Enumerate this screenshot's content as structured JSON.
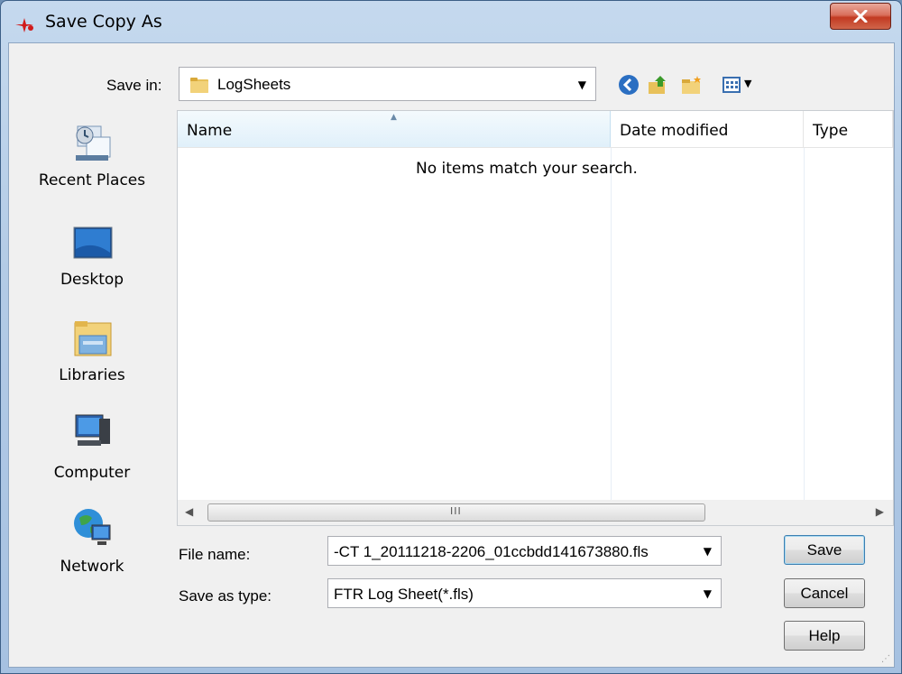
{
  "window": {
    "title": "Save Copy As"
  },
  "save_in": {
    "label": "Save in:",
    "value": "LogSheets"
  },
  "places": [
    {
      "label": "Recent Places",
      "icon": "recent-places-icon"
    },
    {
      "label": "Desktop",
      "icon": "desktop-icon"
    },
    {
      "label": "Libraries",
      "icon": "libraries-icon"
    },
    {
      "label": "Computer",
      "icon": "computer-icon"
    },
    {
      "label": "Network",
      "icon": "network-icon"
    }
  ],
  "list": {
    "columns": [
      "Name",
      "Date modified",
      "Type"
    ],
    "empty_message": "No items match your search.",
    "scroll_grip": "III"
  },
  "file_name": {
    "label": "File name:",
    "value": "-CT 1_20111218-2206_01ccbdd141673880.fls"
  },
  "save_as_type": {
    "label": "Save as type:",
    "value": "FTR Log Sheet(*.fls)"
  },
  "buttons": {
    "save": "Save",
    "cancel": "Cancel",
    "help": "Help"
  },
  "colors": {
    "accent": "#3c7fb1",
    "title_gradient": "#b3cbe6",
    "close": "#c23a22"
  }
}
